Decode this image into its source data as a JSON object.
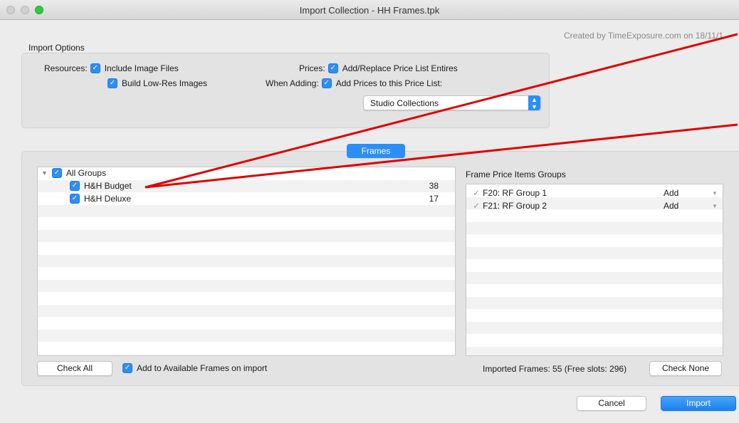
{
  "window": {
    "title": "Import Collection - HH Frames.tpk"
  },
  "credit": "Created by TimeExposure.com on 18/11/1",
  "import_options": {
    "heading": "Import Options",
    "resources_label": "Resources:",
    "include_image_files": "Include Image Files",
    "build_low_res": "Build Low-Res Images",
    "prices_label": "Prices:",
    "add_replace": "Add/Replace Price List Entires",
    "when_adding_label": "When Adding:",
    "add_prices": "Add Prices to this Price List:",
    "price_list_selected": "Studio Collections"
  },
  "tab": {
    "frames": "Frames"
  },
  "groups": {
    "root": "All Groups",
    "items": [
      {
        "name": "H&H Budget",
        "count": "38"
      },
      {
        "name": "H&H Deluxe",
        "count": "17"
      }
    ]
  },
  "frame_price": {
    "heading": "Frame Price Items Groups",
    "items": [
      {
        "name": "F20: RF Group 1",
        "action": "Add"
      },
      {
        "name": "F21: RF Group 2",
        "action": "Add"
      }
    ]
  },
  "bottom": {
    "check_all": "Check All",
    "add_available": "Add to Available Frames on import",
    "imported_status": "Imported Frames: 55 (Free slots: 296)",
    "check_none": "Check None",
    "cancel": "Cancel",
    "import": "Import"
  },
  "colors": {
    "accent": "#2d8ef5",
    "annotation": "#e00000"
  },
  "icons": {
    "checkbox": "checkmark-icon",
    "disclosure": "triangle-down-icon",
    "select_arrow": "updown-chevron-icon"
  }
}
